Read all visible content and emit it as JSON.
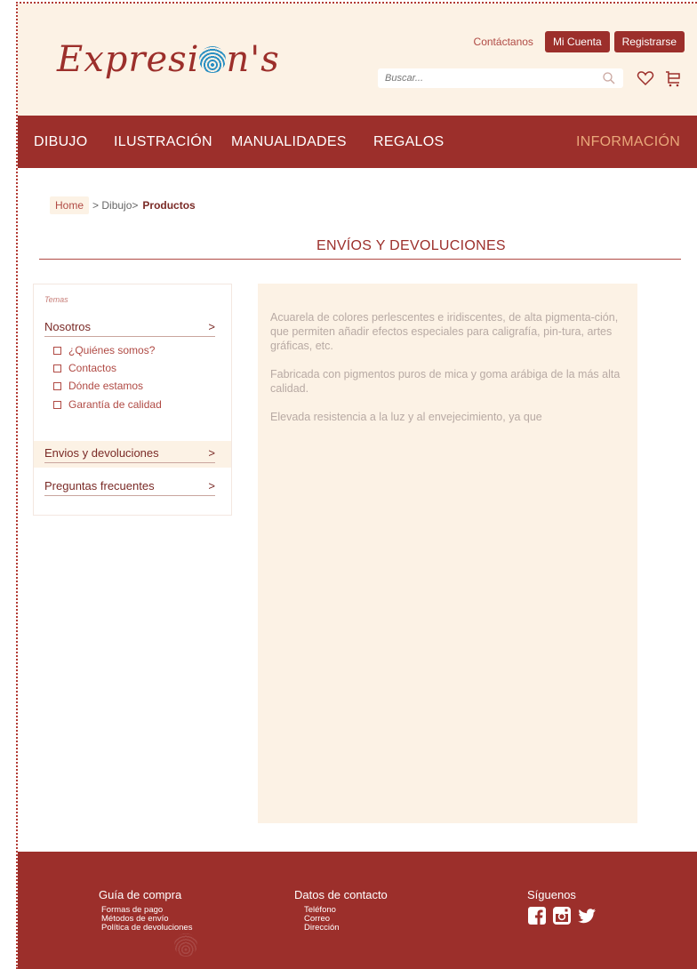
{
  "brand": {
    "name_left": "Expresi",
    "name_right": "n's"
  },
  "header": {
    "contact_label": "Contáctanos",
    "account_label": "Mi Cuenta",
    "register_label": "Registrarse",
    "search_placeholder": "Buscar...",
    "icons": [
      "search-icon",
      "heart-icon",
      "cart-icon"
    ]
  },
  "nav": {
    "items": [
      "DIBUJO",
      "ILUSTRACIÓN",
      "MANUALIDADES",
      "REGALOS"
    ],
    "info_label": "INFORMACIÓN"
  },
  "breadcrumb": {
    "home": "Home",
    "middle": "> Dibujo>",
    "current": "Productos"
  },
  "page": {
    "title": "ENVÍOS Y DEVOLUCIONES"
  },
  "sidebar": {
    "caption": "Temas",
    "sections": [
      {
        "label": "Nosotros",
        "chevron": ">"
      },
      {
        "label": "Envios y devoluciones",
        "chevron": ">"
      },
      {
        "label": "Preguntas frecuentes",
        "chevron": ">"
      }
    ],
    "subitems": [
      "¿Quiénes somos?",
      "Contactos",
      "Dónde estamos",
      "Garantía de calidad"
    ]
  },
  "content": {
    "paragraphs": [
      "Acuarela de colores perlescentes e iridiscentes, de alta pigmenta-ción, que permiten añadir efectos especiales para caligrafía, pin-tura, artes gráficas, etc.",
      "Fabricada con pigmentos puros de mica y goma arábiga de la más alta calidad.",
      "Elevada resistencia a la luz y al envejecimiento, ya que"
    ]
  },
  "footer": {
    "guide": {
      "title": "Guía de compra",
      "links": [
        "Formas de pago",
        "Métodos de envío",
        "Política de devoluciones"
      ]
    },
    "contact": {
      "title": "Datos de contacto",
      "links": [
        "Teléfono",
        "Correo",
        "Dirección"
      ]
    },
    "social": {
      "title": "Síguenos",
      "icons": [
        "facebook-icon",
        "instagram-icon",
        "twitter-icon"
      ]
    }
  },
  "colors": {
    "primary": "#9c2f2b",
    "cream": "#fcf2e5",
    "accent_info": "#e9a87a"
  }
}
